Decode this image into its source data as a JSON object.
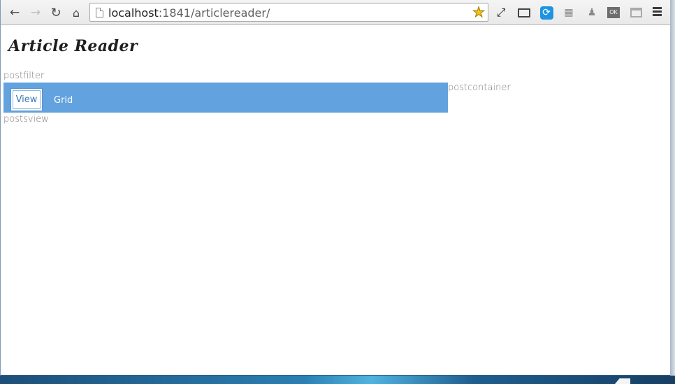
{
  "browser": {
    "back_icon": "arrow-left-icon",
    "forward_icon": "arrow-right-icon",
    "reload_icon": "reload-icon",
    "home_icon": "home-icon",
    "url_host": "localhost",
    "url_rest": ":1841/articlereader/",
    "extensions": [
      "fullscreen-icon",
      "cast-icon",
      "sync-icon",
      "puzzle-icon",
      "robot-icon",
      "ok-icon",
      "box-icon"
    ],
    "ok_label": "OK"
  },
  "page": {
    "title": "Article Reader",
    "postfilter_label": "postfilter",
    "postcontainer_label": "postcontainer",
    "postsview_label": "postsview",
    "view_button": "View",
    "grid_button": "Grid"
  },
  "colors": {
    "filter_bar": "#62a2df",
    "view_text": "#3a78b5"
  }
}
